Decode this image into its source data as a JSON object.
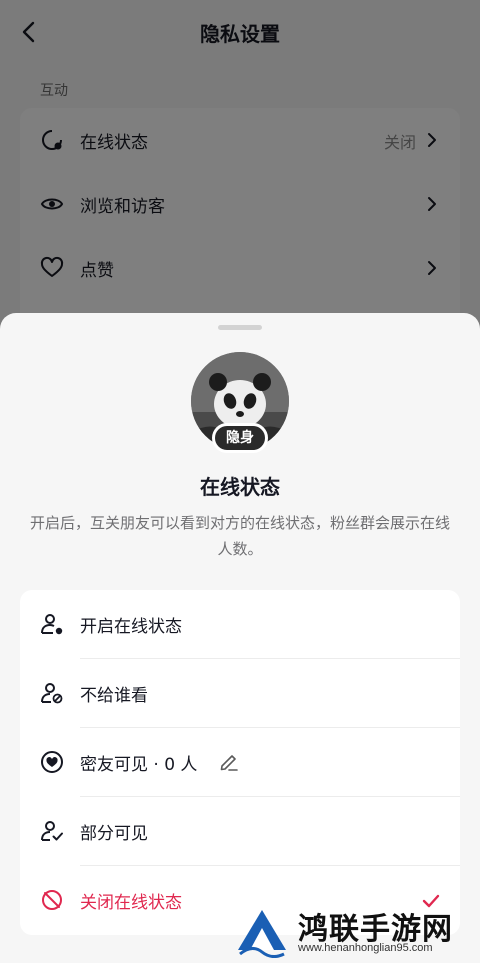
{
  "header": {
    "title": "隐私设置"
  },
  "section": {
    "title": "互动"
  },
  "settings_rows": [
    {
      "label": "在线状态",
      "value": "关闭",
      "icon": "online-status-icon"
    },
    {
      "label": "浏览和访客",
      "value": "",
      "icon": "eye-icon"
    },
    {
      "label": "点赞",
      "value": "",
      "icon": "heart-icon"
    }
  ],
  "sheet": {
    "badge": "隐身",
    "title": "在线状态",
    "description": "开启后，互关朋友可以看到对方的在线状态，粉丝群会展示在线人数。",
    "options": [
      {
        "label": "开启在线状态",
        "icon": "user-online-icon"
      },
      {
        "label": "不给谁看",
        "icon": "user-block-icon"
      },
      {
        "label": "密友可见 · 0 人",
        "icon": "heart-circle-icon"
      },
      {
        "label": "部分可见",
        "icon": "user-check-icon"
      },
      {
        "label": "关闭在线状态",
        "icon": "offline-icon",
        "selected": true
      }
    ]
  },
  "colors": {
    "accent_red": "#e0284f",
    "text": "#161823",
    "muted": "#6f6f72"
  },
  "watermark": {
    "brand": "鸿联手游网",
    "url": "www.henanhonglian95.com"
  }
}
